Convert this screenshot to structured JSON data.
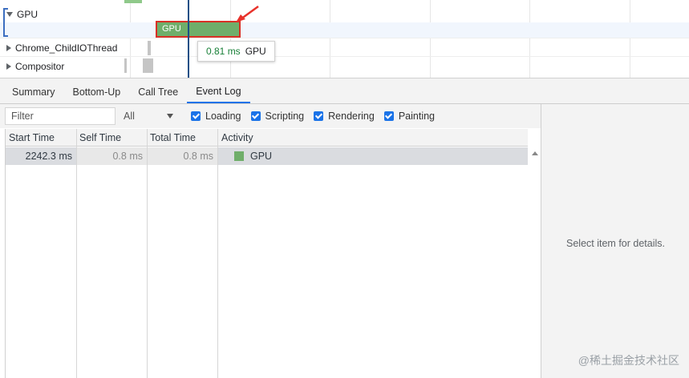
{
  "flame": {
    "tracks": [
      {
        "name": "GPU",
        "expanded": true
      },
      {
        "name": "Chrome_ChildIOThread",
        "expanded": false
      },
      {
        "name": "Compositor",
        "expanded": false
      }
    ],
    "gpu_event_label": "GPU",
    "tooltip": {
      "duration": "0.81 ms",
      "name": "GPU"
    },
    "colors": {
      "gpu_event": "#6fae6a",
      "highlight": "#d93025",
      "cursor": "#1a4f86"
    }
  },
  "tabs": [
    {
      "label": "Summary",
      "active": false
    },
    {
      "label": "Bottom-Up",
      "active": false
    },
    {
      "label": "Call Tree",
      "active": false
    },
    {
      "label": "Event Log",
      "active": true
    }
  ],
  "toolbar": {
    "filter_placeholder": "Filter",
    "duration_select": "All",
    "checkboxes": [
      {
        "label": "Loading",
        "checked": true
      },
      {
        "label": "Scripting",
        "checked": true
      },
      {
        "label": "Rendering",
        "checked": true
      },
      {
        "label": "Painting",
        "checked": true
      }
    ]
  },
  "table": {
    "columns": [
      "Start Time",
      "Self Time",
      "Total Time",
      "Activity"
    ],
    "rows": [
      {
        "start": "2242.3 ms",
        "self": "0.8 ms",
        "total": "0.8 ms",
        "activity": "GPU",
        "activity_color": "#6fae6a"
      }
    ]
  },
  "details": {
    "message": "Select item for details."
  },
  "watermark": "@稀土掘金技术社区"
}
